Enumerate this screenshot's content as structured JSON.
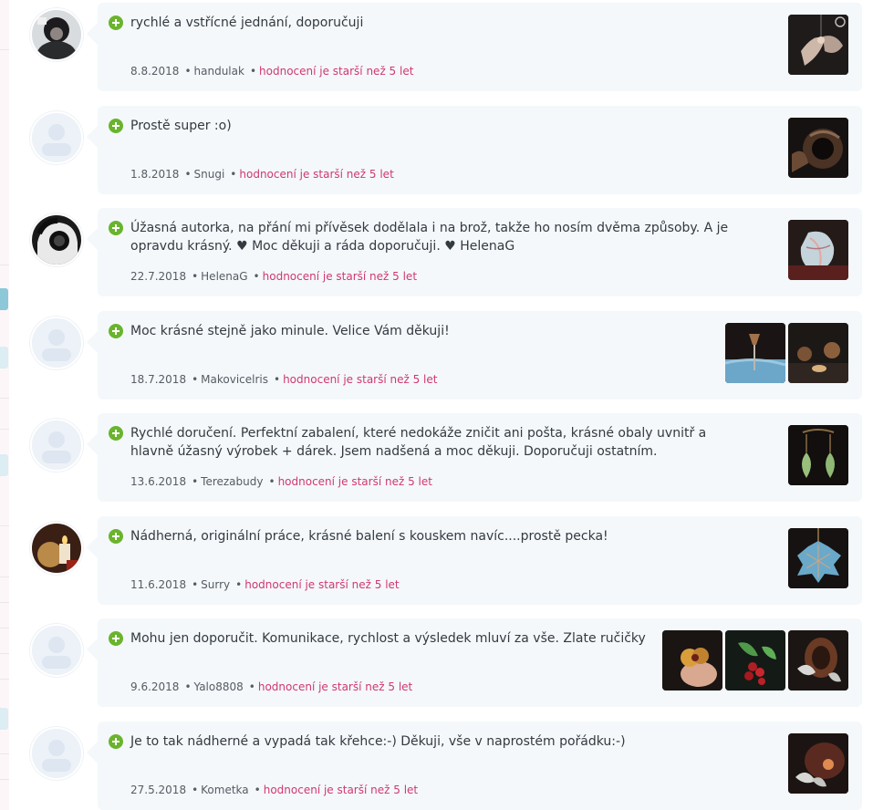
{
  "age_notice": "hodnocení je starší než 5 let",
  "reviews": [
    {
      "text": "rychlé a vstřícné jednání, doporučuji",
      "date": "8.8.2018",
      "user": "handulak",
      "avatar": "photo-person-icon",
      "thumbs": [
        "photo-pendant-wings"
      ]
    },
    {
      "text": "Prostě super :o)",
      "date": "1.8.2018",
      "user": "Snugi",
      "avatar": "default-user-icon",
      "thumbs": [
        "photo-brooch-round"
      ]
    },
    {
      "text": "Úžasná autorka, na přání mi přívěsek dodělala i na brož, takže ho nosím dvěma způsoby. A je opravdu krásný. ♥ Moc děkuji a ráda doporučuji. ♥ HelenaG",
      "date": "22.7.2018",
      "user": "HelenaG",
      "avatar": "photo-camera-person-icon",
      "thumbs": [
        "photo-leaf-pendant"
      ]
    },
    {
      "text": "Moc krásné stejně jako minule. Velice Vám děkuji!",
      "date": "18.7.2018",
      "user": "Makovicelris",
      "avatar": "default-user-icon",
      "thumbs": [
        "photo-hairpin",
        "photo-acorn-earrings"
      ]
    },
    {
      "text": "Rychlé doručení. Perfektní zabalení, které nedokáže zničit ani pošta, krásné obaly uvnitř a hlavně úžasný výrobek + dárek. Jsem nadšená a moc děkuji. Doporučuji ostatním.",
      "date": "13.6.2018",
      "user": "Terezabudy",
      "avatar": "default-user-icon",
      "thumbs": [
        "photo-leaf-earrings"
      ]
    },
    {
      "text": "Nádherná, originální práce, krásné balení s kouskem navíc....prostě pecka!",
      "date": "11.6.2018",
      "user": "Surry",
      "avatar": "photo-candle-icon",
      "thumbs": [
        "photo-blue-leaf-pendant"
      ]
    },
    {
      "text": "Mohu jen doporučit. Komunikace, rychlost a výsledek mluví za vše. Zlate ručičky",
      "date": "9.6.2018",
      "user": "Yalo8808",
      "avatar": "default-user-icon",
      "thumbs": [
        "photo-flower-ring",
        "photo-berry-brooch",
        "photo-leaf-acorn-pendant"
      ]
    },
    {
      "text": "Je to tak nádherné a vypadá tak křehce:-) Děkuji, vše v naprostém pořádku:-)",
      "date": "27.5.2018",
      "user": "Kometka",
      "avatar": "default-user-icon",
      "thumbs": [
        "photo-silver-leaf-bowl"
      ]
    }
  ]
}
